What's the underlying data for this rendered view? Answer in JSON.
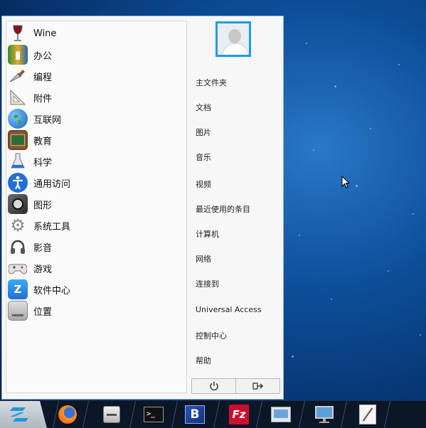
{
  "categories": [
    {
      "label": "Wine",
      "icon": "wine-glass-icon"
    },
    {
      "label": "办公",
      "icon": "office-books-icon"
    },
    {
      "label": "编程",
      "icon": "programming-trowel-icon"
    },
    {
      "label": "附件",
      "icon": "accessories-ruler-icon"
    },
    {
      "label": "互联网",
      "icon": "internet-globe-icon"
    },
    {
      "label": "教育",
      "icon": "education-chalkboard-icon"
    },
    {
      "label": "科学",
      "icon": "science-flask-icon"
    },
    {
      "label": "通用访问",
      "icon": "universal-access-icon"
    },
    {
      "label": "图形",
      "icon": "graphics-icon"
    },
    {
      "label": "系统工具",
      "icon": "system-tools-gear-icon"
    },
    {
      "label": "影音",
      "icon": "multimedia-headphones-icon"
    },
    {
      "label": "游戏",
      "icon": "games-gamepad-icon"
    },
    {
      "label": "软件中心",
      "icon": "software-center-icon"
    },
    {
      "label": "位置",
      "icon": "places-drive-icon"
    }
  ],
  "places": [
    "主文件夹",
    "文档",
    "图片",
    "音乐",
    "视频",
    "最近使用的条目",
    "计算机",
    "网络",
    "连接到",
    "Universal Access",
    "控制中心",
    "帮助"
  ],
  "power_buttons": {
    "shutdown_icon": "power-icon",
    "logout_icon": "logout-icon"
  },
  "taskbar": {
    "start_icon": "zorin-logo-icon",
    "items": [
      {
        "name": "firefox",
        "icon": "firefox-icon"
      },
      {
        "name": "file-manager",
        "icon": "file-cabinet-icon"
      },
      {
        "name": "terminal",
        "icon": "terminal-icon"
      },
      {
        "name": "bluefish",
        "icon": "bluefish-b-icon"
      },
      {
        "name": "filezilla",
        "icon": "filezilla-fz-icon"
      },
      {
        "name": "screenshot",
        "icon": "screenshot-camera-icon"
      },
      {
        "name": "remote-desktop",
        "icon": "monitor-icon"
      },
      {
        "name": "text-editor",
        "icon": "pen-paper-icon"
      }
    ]
  },
  "colors": {
    "accent": "#1f9be6",
    "desktop": "#0d4f9a",
    "taskbar": "#0b1626"
  }
}
